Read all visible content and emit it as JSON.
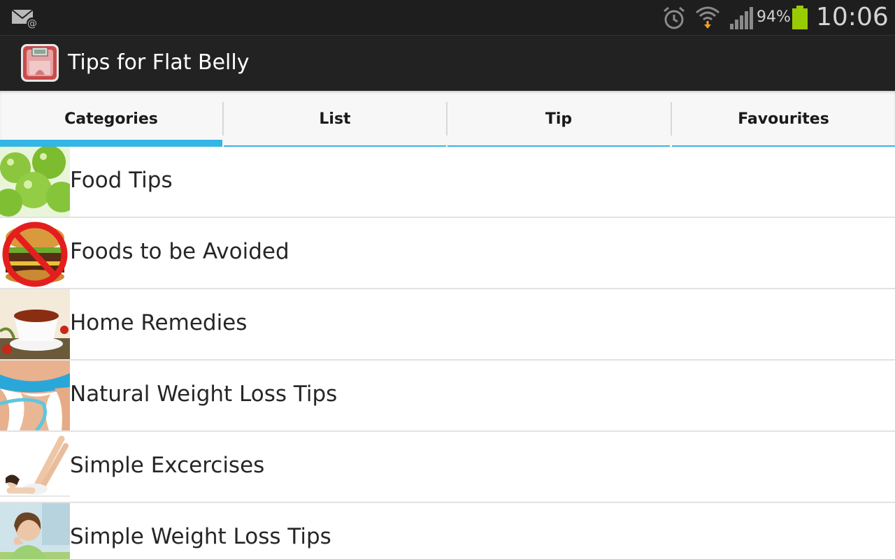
{
  "status_bar": {
    "battery_percent": "94%",
    "time": "10:06",
    "icons": [
      "mail-at-icon",
      "alarm-icon",
      "wifi-icon",
      "signal-icon",
      "battery-icon"
    ],
    "battery_level": 0.94,
    "battery_color": "#99cc00"
  },
  "app": {
    "title": "Tips for Flat Belly",
    "icon": "weight-loss-scale-icon"
  },
  "tabs": [
    {
      "label": "Categories",
      "active": true
    },
    {
      "label": "List",
      "active": false
    },
    {
      "label": "Tip",
      "active": false
    },
    {
      "label": "Favourites",
      "active": false
    }
  ],
  "accent_color": "#33b5e5",
  "categories": [
    {
      "label": "Food Tips",
      "thumb": "green-apples-image"
    },
    {
      "label": "Foods to be Avoided",
      "thumb": "burger-prohibited-image"
    },
    {
      "label": "Home Remedies",
      "thumb": "tea-cup-image"
    },
    {
      "label": "Natural Weight Loss Tips",
      "thumb": "measuring-tape-waist-image"
    },
    {
      "label": "Simple Excercises",
      "thumb": "woman-exercising-image"
    },
    {
      "label": "Simple Weight Loss Tips",
      "thumb": "woman-thinking-image"
    }
  ]
}
